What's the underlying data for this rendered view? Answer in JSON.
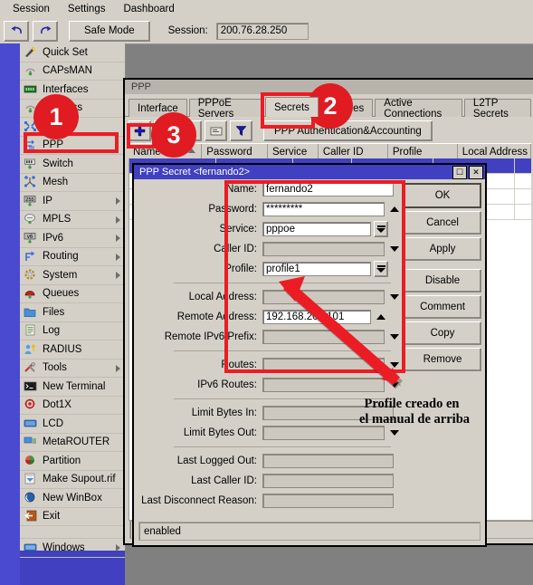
{
  "menubar": {
    "items": [
      "Session",
      "Settings",
      "Dashboard"
    ]
  },
  "toolbar": {
    "undo_icon": "undo-arrow-icon",
    "redo_icon": "redo-arrow-icon",
    "safe_mode_label": "Safe Mode",
    "session_label": "Session:",
    "session_value": "200.76.28.250"
  },
  "sidebar": {
    "items": [
      {
        "label": "Quick Set",
        "icon": "wand-icon",
        "submenu": false
      },
      {
        "label": "CAPsMAN",
        "icon": "antenna-icon",
        "submenu": false
      },
      {
        "label": "Interfaces",
        "icon": "interfaces-icon",
        "submenu": false
      },
      {
        "label": "Wireless",
        "icon": "antenna-icon",
        "submenu": false
      },
      {
        "label": "Bridge",
        "icon": "bridge-icon",
        "submenu": false
      },
      {
        "label": "PPP",
        "icon": "ppp-icon",
        "submenu": false
      },
      {
        "label": "Switch",
        "icon": "switch-icon",
        "submenu": false
      },
      {
        "label": "Mesh",
        "icon": "mesh-icon",
        "submenu": false
      },
      {
        "label": "IP",
        "icon": "ip-icon",
        "submenu": true
      },
      {
        "label": "MPLS",
        "icon": "mpls-icon",
        "submenu": true
      },
      {
        "label": "IPv6",
        "icon": "ipv6-icon",
        "submenu": true
      },
      {
        "label": "Routing",
        "icon": "routing-icon",
        "submenu": true
      },
      {
        "label": "System",
        "icon": "system-icon",
        "submenu": true
      },
      {
        "label": "Queues",
        "icon": "queues-icon",
        "submenu": false
      },
      {
        "label": "Files",
        "icon": "folder-icon",
        "submenu": false
      },
      {
        "label": "Log",
        "icon": "log-icon",
        "submenu": false
      },
      {
        "label": "RADIUS",
        "icon": "radius-icon",
        "submenu": false
      },
      {
        "label": "Tools",
        "icon": "tools-icon",
        "submenu": true
      },
      {
        "label": "New Terminal",
        "icon": "terminal-icon",
        "submenu": false
      },
      {
        "label": "Dot1X",
        "icon": "dot1x-icon",
        "submenu": false
      },
      {
        "label": "LCD",
        "icon": "lcd-icon",
        "submenu": false
      },
      {
        "label": "MetaROUTER",
        "icon": "metarouter-icon",
        "submenu": false
      },
      {
        "label": "Partition",
        "icon": "partition-icon",
        "submenu": false
      },
      {
        "label": "Make Supout.rif",
        "icon": "supout-icon",
        "submenu": false
      },
      {
        "label": "New WinBox",
        "icon": "winbox-icon",
        "submenu": false
      },
      {
        "label": "Exit",
        "icon": "exit-icon",
        "submenu": false
      },
      {
        "label": "Windows",
        "icon": "windows-icon",
        "submenu": true
      }
    ]
  },
  "ppp_window": {
    "title": "PPP",
    "tabs": [
      {
        "label": "Interface",
        "active": false
      },
      {
        "label": "PPPoE Servers",
        "active": false
      },
      {
        "label": "Secrets",
        "active": true
      },
      {
        "label": "Profiles",
        "active": false
      },
      {
        "label": "Active Connections",
        "active": false
      },
      {
        "label": "L2TP Secrets",
        "active": false
      }
    ],
    "toolbar": {
      "add_icon": "plus-icon",
      "remove_icon": "minus-icon",
      "enable_icon": "check-icon",
      "disable_icon": "cross-icon",
      "comment_icon": "comment-icon",
      "filter_icon": "funnel-icon",
      "auth_button_label": "PPP Authentication&Accounting"
    },
    "table_headers": [
      "Name",
      "Password",
      "Service",
      "Caller ID",
      "Profile",
      "Local Address"
    ],
    "status": "enabled"
  },
  "dialog": {
    "title": "PPP Secret <fernando2>",
    "maximize_icon": "maximize-icon",
    "close_icon": "close-icon",
    "fields": [
      {
        "label": "Name:",
        "value": "fernando2",
        "control": "none"
      },
      {
        "label": "Password:",
        "value": "*********",
        "control": "up"
      },
      {
        "label": "Service:",
        "value": "pppoe",
        "control": "combo"
      },
      {
        "label": "Caller ID:",
        "value": "",
        "control": "plain-down",
        "disabled": true
      },
      {
        "label": "Profile:",
        "value": "profile1",
        "control": "combo"
      },
      {
        "label": "Local Address:",
        "value": "",
        "control": "plain-down",
        "disabled": true
      },
      {
        "label": "Remote Address:",
        "value": "192.168.200.101",
        "control": "up"
      },
      {
        "label": "Remote IPv6 Prefix:",
        "value": "",
        "control": "plain-down",
        "disabled": true
      },
      {
        "label": "Routes:",
        "value": "",
        "control": "plain-down",
        "disabled": true
      },
      {
        "label": "IPv6 Routes:",
        "value": "",
        "control": "plain-down",
        "disabled": true
      },
      {
        "label": "Limit Bytes In:",
        "value": "",
        "control": "none",
        "disabled": true
      },
      {
        "label": "Limit Bytes Out:",
        "value": "",
        "control": "plain-down",
        "disabled": true
      },
      {
        "label": "Last Logged Out:",
        "value": "",
        "control": "none",
        "disabled": true
      },
      {
        "label": "Last Caller ID:",
        "value": "",
        "control": "none",
        "disabled": true
      },
      {
        "label": "Last Disconnect Reason:",
        "value": "",
        "control": "none",
        "disabled": true
      }
    ],
    "buttons": [
      "OK",
      "Cancel",
      "Apply",
      "Disable",
      "Comment",
      "Copy",
      "Remove"
    ],
    "status": "enabled"
  },
  "annotations": {
    "badges": [
      "1",
      "2",
      "3"
    ],
    "note_line1": "Profile creado en",
    "note_line2": "el manual de arriba",
    "color": "#e01b22"
  }
}
